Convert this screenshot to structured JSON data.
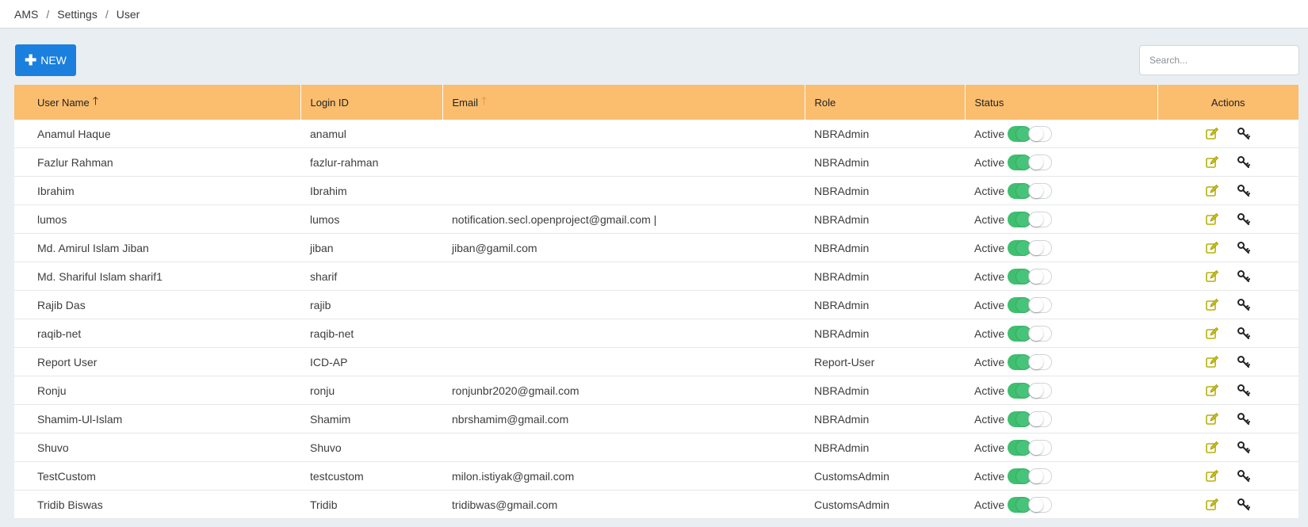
{
  "breadcrumb": [
    "AMS",
    "Settings",
    "User"
  ],
  "toolbar": {
    "new_label": "NEW"
  },
  "search": {
    "placeholder": "Search..."
  },
  "table": {
    "columns": [
      "User Name",
      "Login ID",
      "Email",
      "Role",
      "Status",
      "Actions"
    ],
    "sort_icon_primary": "arrow-up",
    "sort_icon_secondary": "arrow-up",
    "rows": [
      {
        "name": "Anamul Haque",
        "login": "anamul",
        "email": "",
        "role": "NBRAdmin",
        "status": "Active"
      },
      {
        "name": "Fazlur Rahman",
        "login": "fazlur-rahman",
        "email": "",
        "role": "NBRAdmin",
        "status": "Active"
      },
      {
        "name": "Ibrahim",
        "login": "Ibrahim",
        "email": "",
        "role": "NBRAdmin",
        "status": "Active"
      },
      {
        "name": "lumos",
        "login": "lumos",
        "email": "notification.secl.openproject@gmail.com |",
        "role": "NBRAdmin",
        "status": "Active"
      },
      {
        "name": "Md. Amirul Islam Jiban",
        "login": "jiban",
        "email": "jiban@gamil.com",
        "role": "NBRAdmin",
        "status": "Active"
      },
      {
        "name": "Md. Shariful Islam sharif1",
        "login": "sharif",
        "email": "",
        "role": "NBRAdmin",
        "status": "Active"
      },
      {
        "name": "Rajib Das",
        "login": "rajib",
        "email": "",
        "role": "NBRAdmin",
        "status": "Active"
      },
      {
        "name": "raqib-net",
        "login": "raqib-net",
        "email": "",
        "role": "NBRAdmin",
        "status": "Active"
      },
      {
        "name": "Report User",
        "login": "ICD-AP",
        "email": "",
        "role": "Report-User",
        "status": "Active"
      },
      {
        "name": "Ronju",
        "login": "ronju",
        "email": "ronjunbr2020@gmail.com",
        "role": "NBRAdmin",
        "status": "Active"
      },
      {
        "name": "Shamim-Ul-Islam",
        "login": "Shamim",
        "email": "nbrshamim@gmail.com",
        "role": "NBRAdmin",
        "status": "Active"
      },
      {
        "name": "Shuvo",
        "login": "Shuvo",
        "email": "",
        "role": "NBRAdmin",
        "status": "Active"
      },
      {
        "name": "TestCustom",
        "login": "testcustom",
        "email": "milon.istiyak@gmail.com",
        "role": "CustomsAdmin",
        "status": "Active"
      },
      {
        "name": "Tridib Biswas",
        "login": "Tridib",
        "email": "tridibwas@gmail.com",
        "role": "CustomsAdmin",
        "status": "Active"
      }
    ]
  },
  "colors": {
    "header_bg": "#fbbd6e",
    "new_button": "#1b7fdd",
    "toggle_on": "#3fbf6f",
    "edit_icon": "#b5b00a",
    "page_bg": "#e9eef3"
  }
}
